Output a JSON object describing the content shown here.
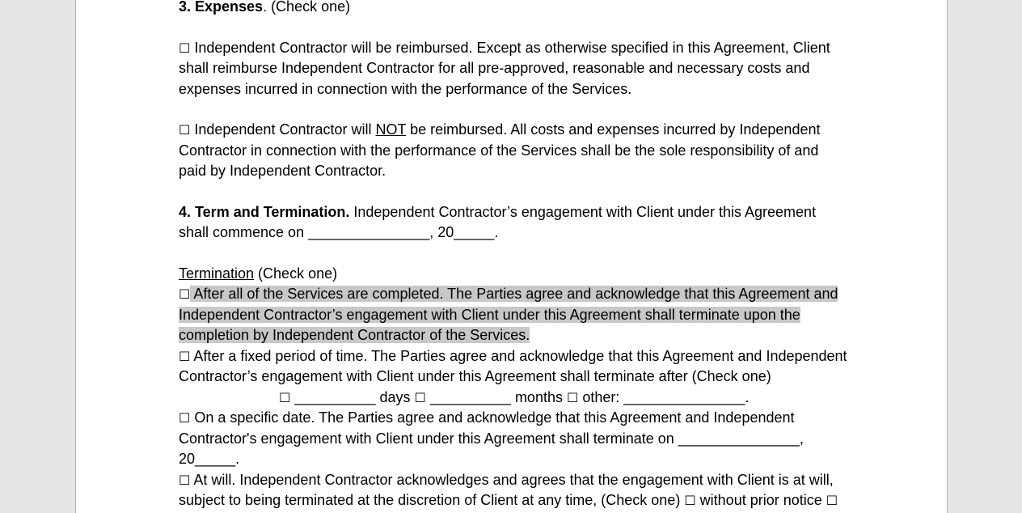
{
  "colors": {
    "app_background": "#e6e6e6",
    "page_background": "#ffffff",
    "selection_highlight": "#c8c8c8"
  },
  "document": {
    "section3": {
      "number_title": "3. Expenses",
      "suffix": ". (Check one)",
      "option1": {
        "checkbox": "☐",
        "text": " Independent Contractor will be reimbursed. Except as otherwise specified in this Agreement, Client shall reimburse Independent Contractor for all pre-approved, reasonable and necessary costs and expenses incurred in connection with the performance of the Services."
      },
      "option2": {
        "checkbox": "☐",
        "text_before": " Independent Contractor will ",
        "underlined": "NOT",
        "text_after": " be reimbursed. All costs and expenses incurred by Independent Contractor in connection with the performance of the Services shall be the sole responsibility of and paid by Independent Contractor."
      }
    },
    "section4": {
      "number_title": "4. Term and Termination.",
      "text": " Independent Contractor’s engagement with Client under this Agreement shall commence on _______________, 20_____.",
      "termination_label": "Termination",
      "termination_suffix": " (Check one)",
      "options": [
        {
          "checkbox": "☐",
          "text": " After all of the Services are completed. The Parties agree and acknowledge that this Agreement and Independent Contractor’s engagement with Client under this Agreement shall terminate upon the completion by Independent Contractor of the Services. ",
          "selected_highlight": true
        },
        {
          "checkbox": "☐",
          "text": " After a fixed period of time. The Parties agree and acknowledge that this Agreement and Independent Contractor’s engagement with Client under this Agreement shall terminate after (Check one)",
          "sub_line": {
            "cb1": "☐",
            "days": " __________ days ",
            "cb2": "☐",
            "months": " __________ months ",
            "cb3": "☐",
            "other": " other: _______________."
          }
        },
        {
          "checkbox": "☐",
          "text": " On a specific date. The Parties agree and acknowledge that this Agreement and Independent Contractor's engagement with Client under this Agreement shall terminate on _______________, 20_____."
        },
        {
          "checkbox": "☐",
          "text": " At will. Independent Contractor acknowledges and agrees that the engagement with Client is at will, subject to being terminated at the discretion of Client at any time, (Check one) ",
          "cb_a": "☐",
          "label_a": " without prior notice ",
          "cb_b": "☐"
        }
      ]
    }
  }
}
